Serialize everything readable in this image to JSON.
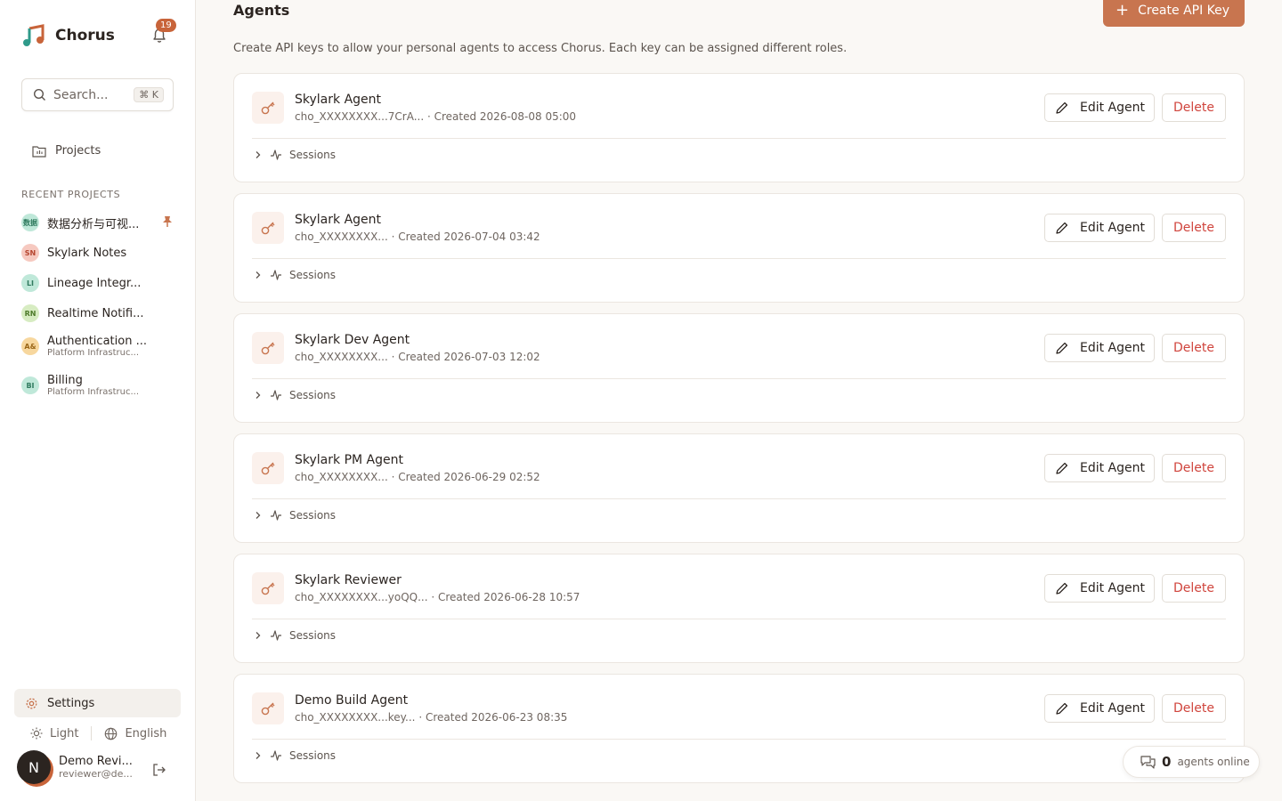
{
  "app": {
    "name": "Chorus",
    "notification_count": "19"
  },
  "sidebar": {
    "search_placeholder": "Search...",
    "search_shortcut": "⌘ K",
    "projects_label": "Projects",
    "recent_title": "RECENT PROJECTS",
    "recent": [
      {
        "initials": "数据",
        "title": "数据分析与可视...",
        "subtitle": "",
        "bg": "#bfe8d9",
        "fg": "#2f7a5e",
        "pinned": true
      },
      {
        "initials": "SN",
        "title": "Skylark Notes",
        "subtitle": "",
        "bg": "#f6c9c0",
        "fg": "#b5452f",
        "pinned": false
      },
      {
        "initials": "LI",
        "title": "Lineage Integr...",
        "subtitle": "",
        "bg": "#bfe8d9",
        "fg": "#2f7a5e",
        "pinned": false
      },
      {
        "initials": "RN",
        "title": "Realtime Notifi...",
        "subtitle": "",
        "bg": "#d7ecc2",
        "fg": "#4d7a2a",
        "pinned": false
      },
      {
        "initials": "A&",
        "title": "Authentication ...",
        "subtitle": "Platform Infrastruc...",
        "bg": "#f7d79e",
        "fg": "#9a6516",
        "pinned": false
      },
      {
        "initials": "BI",
        "title": "Billing",
        "subtitle": "Platform Infrastruc...",
        "bg": "#bfe8d9",
        "fg": "#2f7a5e",
        "pinned": false
      }
    ],
    "settings_label": "Settings",
    "theme_label": "Light",
    "language_label": "English",
    "user": {
      "initial": "N",
      "name": "Demo Revi...",
      "email": "reviewer@de..."
    }
  },
  "main": {
    "title": "Agents",
    "create_button": "Create API Key",
    "subtitle": "Create API keys to allow your personal agents to access Chorus. Each key can be assigned different roles.",
    "edit_label": "Edit Agent",
    "delete_label": "Delete",
    "sessions_label": "Sessions",
    "agents": [
      {
        "name": "Skylark Agent",
        "key": "cho_XXXXXXXX...7CrA...",
        "created": "Created 2026-08-08 05:00"
      },
      {
        "name": "Skylark Agent",
        "key": "cho_XXXXXXXX...",
        "created": "Created 2026-07-04 03:42"
      },
      {
        "name": "Skylark Dev Agent",
        "key": "cho_XXXXXXXX...",
        "created": "Created 2026-07-03 12:02"
      },
      {
        "name": "Skylark PM Agent",
        "key": "cho_XXXXXXXX...",
        "created": "Created 2026-06-29 02:52"
      },
      {
        "name": "Skylark Reviewer",
        "key": "cho_XXXXXXXX...yoQQ...",
        "created": "Created 2026-06-28 10:57"
      },
      {
        "name": "Demo Build Agent",
        "key": "cho_XXXXXXXX...key...",
        "created": "Created 2026-06-23 08:35"
      }
    ]
  },
  "online": {
    "count": "0",
    "label": "agents online"
  },
  "colors": {
    "accent": "#c8754f",
    "danger": "#d0453d",
    "background": "#faf8f5"
  }
}
